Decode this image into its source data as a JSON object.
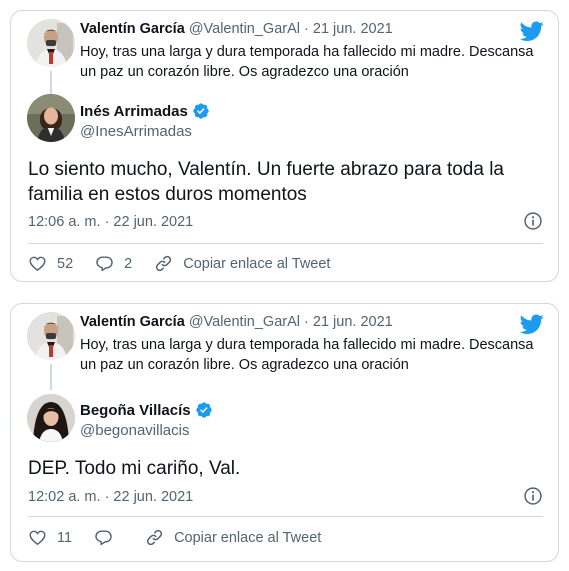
{
  "colors": {
    "twitter_blue": "#1d9bf0",
    "text_primary": "#0f1419",
    "text_secondary": "#536471",
    "border": "#cfd9de"
  },
  "icons": [
    "twitter-bird-icon",
    "verified-badge-icon",
    "info-icon",
    "heart-icon",
    "reply-icon",
    "link-icon"
  ],
  "tweets": [
    {
      "parent": {
        "name": "Valentín García",
        "handle": "@Valentin_GarAl",
        "separator": "·",
        "date": "21 jun. 2021",
        "text": "Hoy, tras una larga y dura temporada ha fallecido mi madre. Descansa un paz un corazón libre. Os agradezco una oración"
      },
      "reply": {
        "name": "Inés Arrimadas",
        "handle": "@InesArrimadas",
        "verified": true,
        "text": "Lo siento mucho, Valentín. Un fuerte abrazo para toda la familia en estos duros momentos",
        "timestamp": "12:06 a. m. · 22 jun. 2021"
      },
      "actions": {
        "likes": "52",
        "replies": "2",
        "copy_link": "Copiar enlace al Tweet"
      }
    },
    {
      "parent": {
        "name": "Valentín García",
        "handle": "@Valentin_GarAl",
        "separator": "·",
        "date": "21 jun. 2021",
        "text": "Hoy, tras una larga y dura temporada ha fallecido mi madre. Descansa un paz un corazón libre. Os agradezco una oración"
      },
      "reply": {
        "name": "Begoña Villacís",
        "handle": "@begonavillacis",
        "verified": true,
        "text": "DEP. Todo mi cariño, Val.",
        "timestamp": "12:02 a. m. · 22 jun. 2021"
      },
      "actions": {
        "likes": "11",
        "replies": "",
        "copy_link": "Copiar enlace al Tweet"
      }
    }
  ]
}
